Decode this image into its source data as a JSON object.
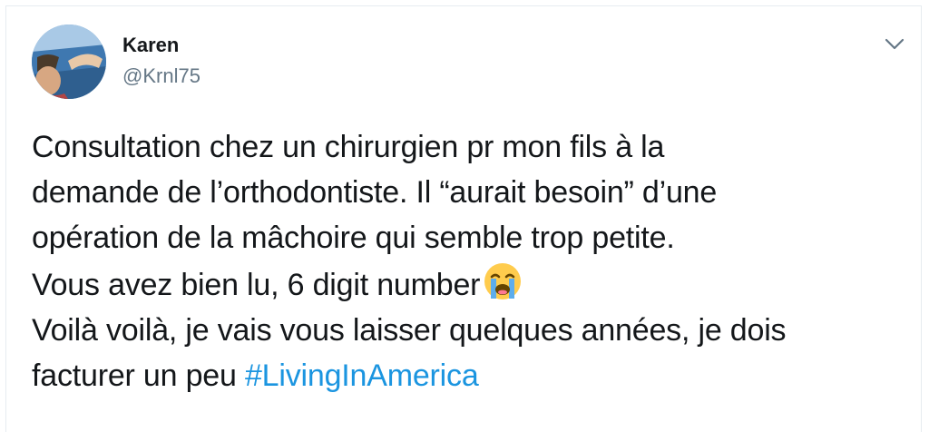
{
  "author": {
    "name": "Karen",
    "handle": "@Krnl75"
  },
  "tweet": {
    "line1": "Consultation chez un chirurgien pr mon fils à la",
    "line2": "demande de l’orthodontiste. Il “aurait besoin” d’une",
    "line3": "opération de la mâchoire qui semble trop petite.",
    "line4": "Vous avez bien lu, 6 digit number",
    "line5": "Voilà voilà, je vais vous laisser quelques années, je dois",
    "line6_prefix": "facturer un peu ",
    "hashtag": "#LivingInAmerica"
  },
  "icons": {
    "menu": "chevron-down-icon",
    "emoji": "loudly-crying-face-emoji"
  },
  "colors": {
    "hashtag": "#1b95e0",
    "text": "#14171a",
    "handle": "#657786",
    "border": "#e6ecf0"
  }
}
